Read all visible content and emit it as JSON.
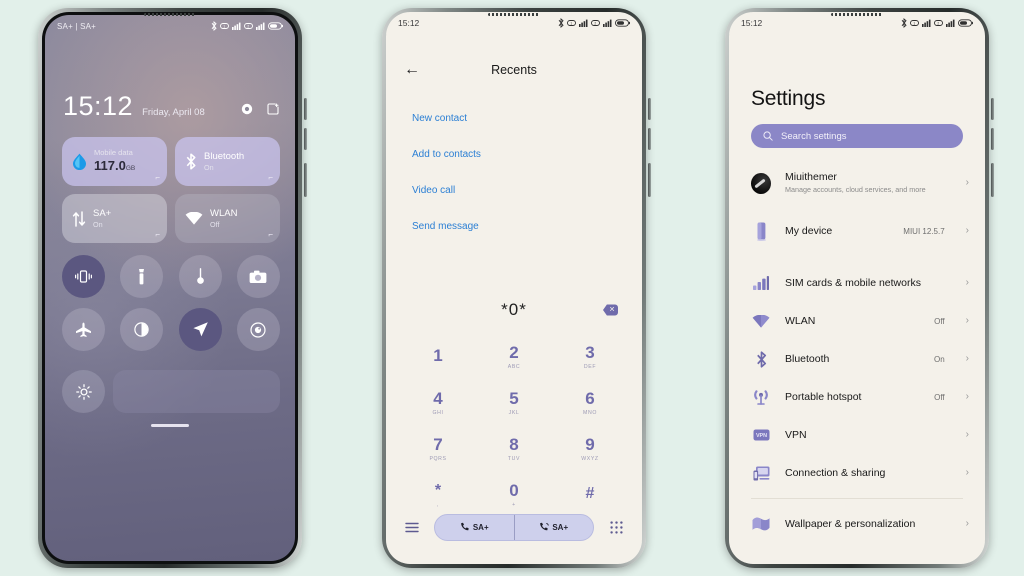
{
  "canvas": {
    "background": "#e2f0ea"
  },
  "theme": {
    "accent": "#6f6bab",
    "search_bg": "#8b87c7",
    "link": "#2b7fd4",
    "screen_bg": "#f4f1ea"
  },
  "phone1": {
    "name": "control-center",
    "statusbar": {
      "carrier": "SA+ | SA+",
      "icons": [
        "bluetooth-icon",
        "sim1-icon",
        "signal1-icon",
        "sim2-icon",
        "signal2-icon",
        "battery-icon"
      ]
    },
    "clock": {
      "time": "15:12",
      "date": "Friday, April 08"
    },
    "header_icons": [
      "settings-gear-icon",
      "edit-tiles-icon"
    ],
    "tiles": [
      {
        "name": "mobile-data",
        "label": "Mobile data",
        "value": "117.0",
        "unit": "GB",
        "icon": "data-drop-icon",
        "style": "light"
      },
      {
        "name": "bluetooth",
        "label": "Bluetooth",
        "state": "On",
        "icon": "bluetooth-icon",
        "style": "light"
      },
      {
        "name": "sa-plus",
        "label": "SA+",
        "state": "On",
        "icon": "data-transfer-icon",
        "style": "dim"
      },
      {
        "name": "wlan",
        "label": "WLAN",
        "state": "Off",
        "icon": "wifi-icon",
        "style": "dim2"
      }
    ],
    "toggles_row1": [
      {
        "name": "vibrate",
        "icon": "vibrate-icon",
        "active": true
      },
      {
        "name": "flashlight",
        "icon": "flashlight-icon",
        "active": false
      },
      {
        "name": "screenshot",
        "icon": "screenshot-icon",
        "active": false
      },
      {
        "name": "camera",
        "icon": "camera-icon",
        "active": false
      }
    ],
    "toggles_row2": [
      {
        "name": "airplane-mode",
        "icon": "airplane-icon",
        "active": false
      },
      {
        "name": "dark-mode",
        "icon": "dark-mode-icon",
        "active": false
      },
      {
        "name": "location",
        "icon": "location-arrow-icon",
        "active": true
      },
      {
        "name": "screen-record",
        "icon": "record-icon",
        "active": false
      }
    ],
    "brightness": {
      "name": "brightness-slider",
      "icon": "brightness-icon"
    }
  },
  "phone2": {
    "name": "dialer",
    "statusbar": {
      "time": "15:12"
    },
    "appbar": {
      "back_icon": "back-arrow-icon",
      "title": "Recents"
    },
    "menu": [
      {
        "label": "New contact"
      },
      {
        "label": "Add to contacts"
      },
      {
        "label": "Video call"
      },
      {
        "label": "Send message"
      }
    ],
    "input": {
      "number": "*0*",
      "delete_icon": "backspace-icon"
    },
    "keypad": [
      [
        {
          "digit": "1",
          "letters": ""
        },
        {
          "digit": "2",
          "letters": "ABC"
        },
        {
          "digit": "3",
          "letters": "DEF"
        }
      ],
      [
        {
          "digit": "4",
          "letters": "GHI"
        },
        {
          "digit": "5",
          "letters": "JKL"
        },
        {
          "digit": "6",
          "letters": "MNO"
        }
      ],
      [
        {
          "digit": "7",
          "letters": "PQRS"
        },
        {
          "digit": "8",
          "letters": "TUV"
        },
        {
          "digit": "9",
          "letters": "WXYZ"
        }
      ],
      [
        {
          "digit": "*",
          "letters": ","
        },
        {
          "digit": "0",
          "letters": "+"
        },
        {
          "digit": "#",
          "letters": ""
        }
      ]
    ],
    "bottombar": {
      "menu_icon": "hamburger-icon",
      "call_buttons": [
        {
          "label": "SA+",
          "icon": "call-sim1-icon"
        },
        {
          "label": "SA+",
          "icon": "call-sim2-icon"
        }
      ],
      "keypad_icon": "keypad-grid-icon"
    }
  },
  "phone3": {
    "name": "settings",
    "statusbar": {
      "time": "15:12"
    },
    "title": "Settings",
    "search": {
      "placeholder": "Search settings",
      "icon": "search-icon"
    },
    "account": {
      "name": "Miuithemer",
      "subtitle": "Manage accounts, cloud services, and more",
      "icon": "avatar"
    },
    "items": [
      {
        "label": "My device",
        "value": "MIUI 12.5.7",
        "icon": "device-icon"
      },
      {
        "label": "SIM cards & mobile networks",
        "value": "",
        "icon": "signal-bars-icon"
      },
      {
        "label": "WLAN",
        "value": "Off",
        "icon": "wifi-icon"
      },
      {
        "label": "Bluetooth",
        "value": "On",
        "icon": "bluetooth-icon"
      },
      {
        "label": "Portable hotspot",
        "value": "Off",
        "icon": "hotspot-icon"
      },
      {
        "label": "VPN",
        "value": "",
        "icon": "vpn-icon"
      },
      {
        "label": "Connection & sharing",
        "value": "",
        "icon": "connection-sharing-icon"
      },
      {
        "label": "Wallpaper & personalization",
        "value": "",
        "icon": "wallpaper-icon"
      }
    ]
  }
}
